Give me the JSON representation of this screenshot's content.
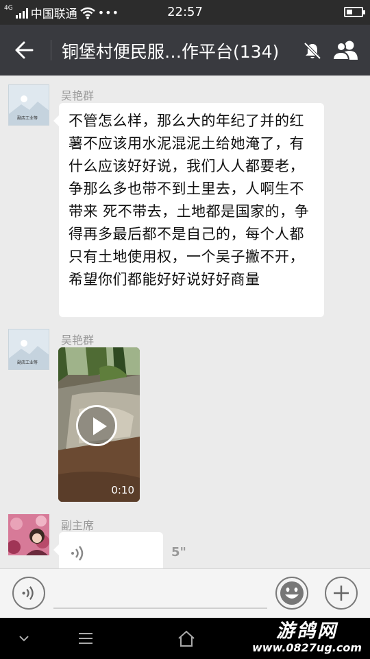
{
  "status_bar": {
    "network": "4G",
    "carrier": "中国联通",
    "more": "•••",
    "time": "22:57"
  },
  "header": {
    "back_icon": "back-arrow-icon",
    "title": "铜堡村便民服…作平台(134)",
    "mute_icon": "bell-muted-icon",
    "members_icon": "group-members-icon"
  },
  "messages": [
    {
      "sender": "吴艳群",
      "avatar_label": "副店工业等",
      "type": "text",
      "text": "不管怎么样，那么大的年纪了并的红薯不应该用水泥混泥土给她淹了，有什么应该好好说，我们人人都要老，争那么多也带不到土里去，人啊生不带来 死不带去，土地都是国家的，争得再多最后都不是自己的，每个人都只有土地使用权，一个吴子撇不开，希望你们都能好好说好好商量"
    },
    {
      "sender": "吴艳群",
      "avatar_label": "副店工业等",
      "type": "video",
      "duration": "0:10"
    },
    {
      "sender": "副主席",
      "type": "voice",
      "length": "5\""
    }
  ],
  "input_bar": {
    "voice_icon": "voice-mode-icon",
    "emoji_icon": "emoji-icon",
    "plus_icon": "plus-icon"
  },
  "nav_bar": {
    "watermark_name": "游鸽网",
    "watermark_url": "www.0827ug.com"
  },
  "colors": {
    "title_bar": "#393a3f",
    "status_bar": "#2c2c2c",
    "chat_bg": "#ebebeb",
    "bubble": "#ffffff"
  }
}
